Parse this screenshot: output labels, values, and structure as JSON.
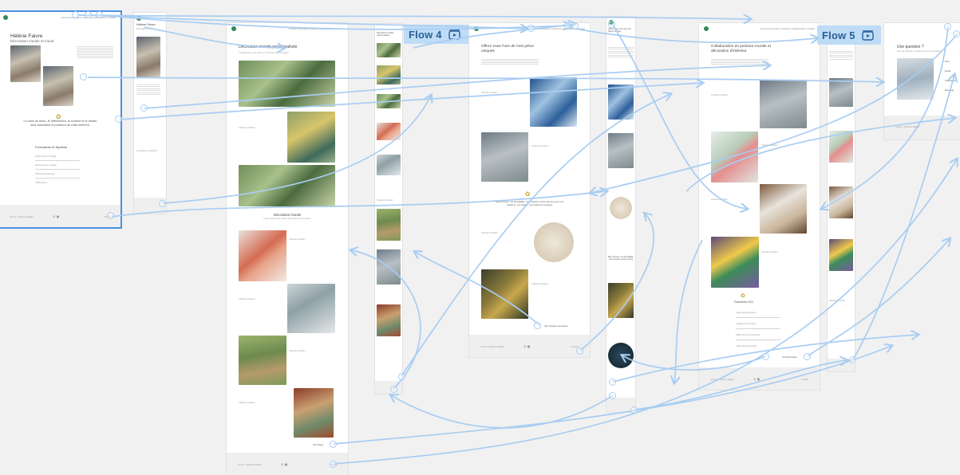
{
  "canvas": {
    "accent": "#4a90e2",
    "connector_color": "#a9cdf2",
    "badge_bg": "#bfdcf7",
    "badge_text_color": "#2a5f97"
  },
  "flows": [
    {
      "label": "Flow 4",
      "icon": "flow-play-icon"
    },
    {
      "label": "Flow 5",
      "icon": "flow-play-icon"
    }
  ],
  "frame_home": {
    "title": "Hélène Faivre",
    "subtitle": "Décoration murale et mural",
    "quote": "Le sens du beau, le raffinement, la couleur et le dessin sont essentiels et porteurs de votre intérieur.",
    "section": "Formations et Diplôme",
    "list": [
      "2004 Cursus en Design",
      "2001 Ecole de Création",
      "2002 Ecole Nationale",
      "2008 Ateliers"
    ],
    "footer_left": "Accueil · Mentions légales",
    "footer_right": "Contact"
  },
  "frame_home_mobile": {
    "title": "Hélène Faivre",
    "subtitle": "Décoration et mural",
    "section": "Formations et Diplôme"
  },
  "frame_deco": {
    "title": "Décoration murale personnalisée",
    "subtitle": "Transformez vos murs en œuvres d'art uniques",
    "section": "Décoration murale",
    "section_sub": "Lorem ipsum lorem ipsum lorem ipsum lorem ipsum",
    "link": "Voir Projets",
    "card_label": "Chambre d'enfant",
    "footer_left": "Accueil · Mentions légales",
    "footer_right": "Contact"
  },
  "frame_deco_mobile": {
    "title": "Décoration murale personnalisée",
    "card_label": "Chambre d'enfant"
  },
  "frame_pieces": {
    "title": "Offrez-vous l'une de mes pièce uniques",
    "card_label": "Chambre d'enfant",
    "quote": "Mon univers, ma sensibilité, mon travail à votre service pour vos maisons, vos hôtels, vos intérieurs uniques",
    "link": "Voir Créations de bureaux",
    "footer_left": "Accueil · Mentions légales",
    "footer_right": "Contact"
  },
  "frame_pieces_mobile": {
    "title": "Offrez-vous l'une de mes pièce uniques",
    "quote": "Mon univers, ma sensibilité, mon travail à votre service"
  },
  "frame_collab": {
    "title": "Collaboration en peinture murale et décoration d'intérieur",
    "card_label": "Chambre d'enfant",
    "section": "Partenaires 2021",
    "partners": [
      "Stage Aquarelle Maria",
      "Château de Crémieux",
      "Palais Princier de Monaco",
      "Atelier Pascal Legrand"
    ],
    "link": "Voir Partenaires",
    "footer_left": "Accueil · Mentions légales",
    "footer_right": "Contact"
  },
  "frame_collab_mobile": {
    "title": "Collaboration en peinture murale",
    "section": "Partenaires 2021"
  },
  "frame_contact": {
    "title": "Une question ?",
    "subtitle": "Oui, bien entendu, n'hésitez pas à me contacter",
    "fields": [
      "Nom",
      "Email",
      "Téléphone",
      "Message"
    ],
    "footer_left": "Accueil · Mentions légales"
  },
  "nav_links": "Accueil  Décoration  Créations  Collaboration  Contact"
}
